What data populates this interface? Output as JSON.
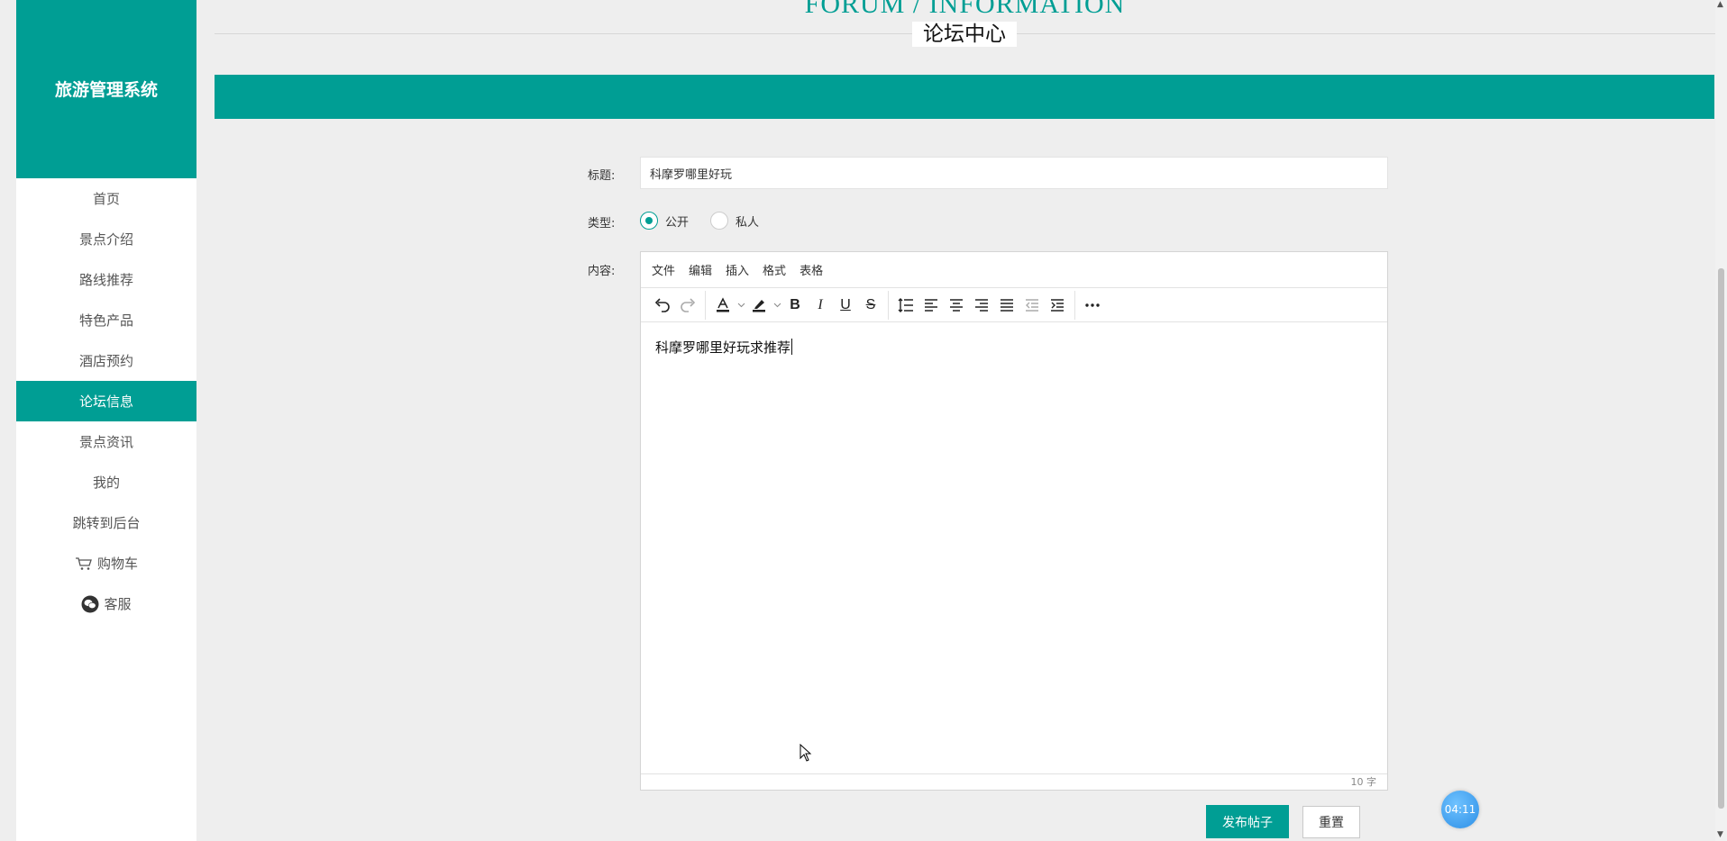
{
  "sidebar": {
    "brand": "旅游管理系统",
    "items": [
      {
        "label": "首页"
      },
      {
        "label": "景点介绍"
      },
      {
        "label": "路线推荐"
      },
      {
        "label": "特色产品"
      },
      {
        "label": "酒店预约"
      },
      {
        "label": "论坛信息",
        "active": true
      },
      {
        "label": "景点资讯"
      },
      {
        "label": "我的"
      },
      {
        "label": "跳转到后台"
      },
      {
        "label": "购物车",
        "icon": "cart-icon"
      },
      {
        "label": "客服",
        "icon": "wechat-icon"
      }
    ]
  },
  "header": {
    "title_en": "FORUM / INFORMATION",
    "title_cn": "论坛中心"
  },
  "form": {
    "title_label": "标题:",
    "title_value": "科摩罗哪里好玩",
    "type_label": "类型:",
    "type_options": [
      "公开",
      "私人"
    ],
    "type_selected": "公开",
    "content_label": "内容:",
    "editor": {
      "menu": [
        "文件",
        "编辑",
        "插入",
        "格式",
        "表格"
      ],
      "content": "科摩罗哪里好玩求推荐",
      "word_count": "10 字"
    },
    "submit_label": "发布帖子",
    "reset_label": "重置"
  },
  "timer": "04:11",
  "colors": {
    "accent": "#009e94",
    "background": "#eeeeee"
  }
}
